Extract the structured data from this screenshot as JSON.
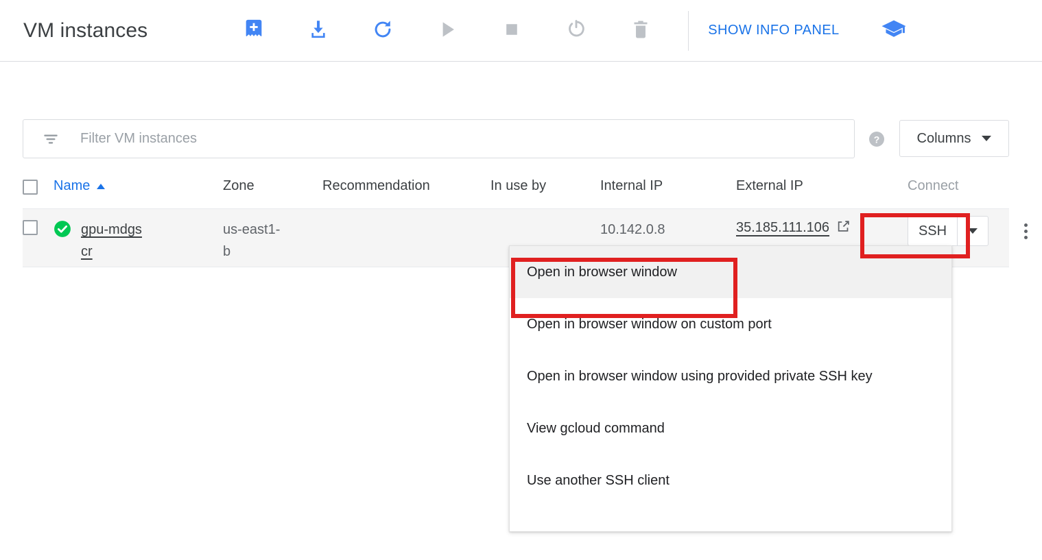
{
  "header": {
    "title": "VM instances",
    "show_info_panel": "SHOW INFO PANEL",
    "toolbar": [
      {
        "name": "create-instance-icon",
        "label": "Create instance",
        "state": "enabled",
        "color": "#4285f4"
      },
      {
        "name": "import-vm-icon",
        "label": "Import VM",
        "state": "enabled",
        "color": "#4285f4"
      },
      {
        "name": "refresh-icon",
        "label": "Refresh",
        "state": "enabled",
        "color": "#4285f4"
      },
      {
        "name": "start-icon",
        "label": "Start / Resume",
        "state": "disabled",
        "color": "#bdc1c6"
      },
      {
        "name": "stop-icon",
        "label": "Stop",
        "state": "disabled",
        "color": "#bdc1c6"
      },
      {
        "name": "reset-icon",
        "label": "Reset",
        "state": "disabled",
        "color": "#bdc1c6"
      },
      {
        "name": "delete-icon",
        "label": "Delete",
        "state": "disabled",
        "color": "#bdc1c6"
      }
    ],
    "education_icon": "graduation-cap-icon"
  },
  "filter": {
    "placeholder": "Filter VM instances",
    "value": "",
    "help_label": "?",
    "columns_label": "Columns"
  },
  "table": {
    "columns": [
      {
        "key": "name",
        "label": "Name",
        "sorted": true,
        "sort_direction": "asc",
        "accent": "#1a73e8"
      },
      {
        "key": "zone",
        "label": "Zone"
      },
      {
        "key": "recommendation",
        "label": "Recommendation"
      },
      {
        "key": "in_use_by",
        "label": "In use by"
      },
      {
        "key": "internal_ip",
        "label": "Internal IP"
      },
      {
        "key": "external_ip",
        "label": "External IP"
      },
      {
        "key": "connect",
        "label": "Connect",
        "muted": true
      }
    ],
    "rows": [
      {
        "selected": false,
        "status": "running",
        "status_color": "#00c853",
        "name": "gpu-mdgscr",
        "zone": "us-east1-b",
        "recommendation": "",
        "in_use_by": "",
        "internal_ip": "10.142.0.8",
        "external_ip": "35.185.111.106",
        "connect_label": "SSH"
      }
    ]
  },
  "ssh_menu": {
    "open": true,
    "items": [
      {
        "label": "Open in browser window",
        "highlighted": true
      },
      {
        "label": "Open in browser window on custom port",
        "highlighted": false
      },
      {
        "label": "Open in browser window using provided private SSH key",
        "highlighted": false
      },
      {
        "label": "View gcloud command",
        "highlighted": false
      },
      {
        "label": "Use another SSH client",
        "highlighted": false
      }
    ]
  },
  "annotations": {
    "highlight_color": "#e02020",
    "boxes": [
      {
        "target": "ssh-split-button"
      },
      {
        "target": "menu-item-open-in-browser-window"
      }
    ]
  }
}
